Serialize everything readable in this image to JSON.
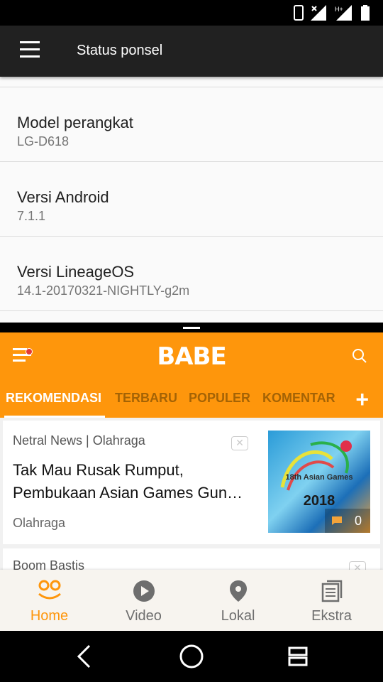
{
  "status_bar": {
    "network_label": "H+"
  },
  "settings": {
    "title": "Status ponsel",
    "items": [
      {
        "title": "Model perangkat",
        "summary": "LG-D618"
      },
      {
        "title": "Versi Android",
        "summary": "7.1.1"
      },
      {
        "title": "Versi LineageOS",
        "summary": "14.1-20170321-NIGHTLY-g2m"
      }
    ]
  },
  "babe": {
    "logo": "BABE",
    "tabs": [
      "REKOMENDASI",
      "TERBARU",
      "POPULER",
      "KOMENTAR"
    ],
    "add_tab": "+",
    "cards": [
      {
        "source": "Netral News | Olahraga",
        "title_line1": "Tak Mau Rusak Rumput,",
        "title_line2": "Pembukaan Asian Games Gun…",
        "category": "Olahraga",
        "thumb_text": "18th Asian Games",
        "thumb_year": "2018",
        "comments": "0"
      },
      {
        "source": "Boom Bastis"
      }
    ],
    "nav": [
      "Home",
      "Video",
      "Lokal",
      "Ekstra"
    ],
    "colors": {
      "brand": "#fe960c"
    }
  }
}
